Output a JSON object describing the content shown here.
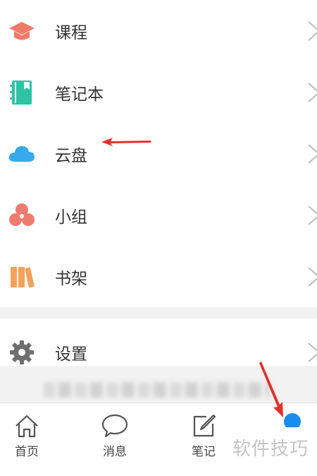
{
  "menu": {
    "items": [
      {
        "label": "课程",
        "icon": "graduation-cap-icon",
        "color": "#f07a6a"
      },
      {
        "label": "笔记本",
        "icon": "notebook-icon",
        "color": "#2dc3a3"
      },
      {
        "label": "云盘",
        "icon": "cloud-icon",
        "color": "#3aa9ec"
      },
      {
        "label": "小组",
        "icon": "group-icon",
        "color": "#ef7b6f"
      },
      {
        "label": "书架",
        "icon": "bookshelf-icon",
        "color": "#f2a25a"
      }
    ],
    "settings": {
      "label": "设置",
      "icon": "gear-icon",
      "color": "#6e6e6e"
    }
  },
  "tabbar": {
    "tabs": [
      {
        "label": "首页",
        "icon": "home-icon"
      },
      {
        "label": "消息",
        "icon": "chat-bubble-icon"
      },
      {
        "label": "笔记",
        "icon": "edit-note-icon"
      }
    ],
    "active_dot_color": "#1a8cf0"
  },
  "watermark": {
    "text": "软件技巧"
  },
  "annotation_color": "#e2302a"
}
